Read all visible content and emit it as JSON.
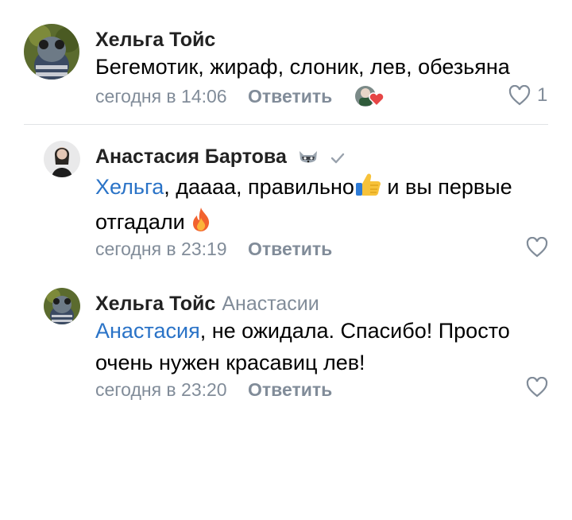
{
  "comments": [
    {
      "author": "Хельга Тойс",
      "text": "Бегемотик, жираф, слоник, лев, обезьяна",
      "time": "сегодня в 14:06",
      "reply_label": "Ответить",
      "likes": "1"
    },
    {
      "author": "Анастасия Бартова",
      "mention": "Хельга",
      "text_part1": ", даааа, правильно",
      "text_part2": " и вы первые",
      "text_line2": "отгадали ",
      "time": "сегодня в 23:19",
      "reply_label": "Ответить"
    },
    {
      "author": "Хельга Тойс",
      "reply_to": "Анастасии",
      "mention": "Анастасия",
      "text_line1": ", не ожидала. Спасибо! Просто",
      "text_line2": "очень нужен красавиц лев!",
      "time": "сегодня в 23:20",
      "reply_label": "Ответить"
    }
  ],
  "colors": {
    "link": "#2a73c7",
    "secondary": "#818c99",
    "heart": "#e64646"
  },
  "icons": [
    "heart-outline-icon",
    "verified-check-icon",
    "raccoon-icon",
    "thumbs-up-emoji",
    "fire-emoji",
    "liked-avatar-heart-icon"
  ]
}
